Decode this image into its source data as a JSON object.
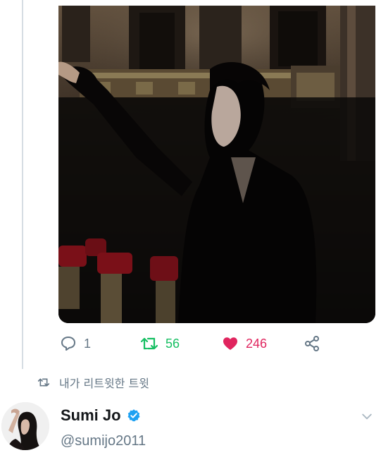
{
  "tweet": {
    "media": {
      "description_icon": "video-media",
      "colors": {
        "background": "#0d0b0a",
        "seat_red": "#7a1018",
        "gold": "#8a7a55"
      }
    },
    "actions": {
      "reply_count": "1",
      "retweet_count": "56",
      "like_count": "246",
      "colors": {
        "muted": "#657786",
        "retweet": "#17bf63",
        "like": "#e0245e"
      }
    }
  },
  "retweet_context": {
    "icon": "retweet-icon",
    "label": "내가 리트윗한 트윗"
  },
  "next_tweet": {
    "author": {
      "display_name": "Sumi Jo",
      "handle": "@sumijo2011",
      "verified": true,
      "verified_color": "#1da1f2"
    },
    "menu_icon": "chevron-down-icon"
  }
}
